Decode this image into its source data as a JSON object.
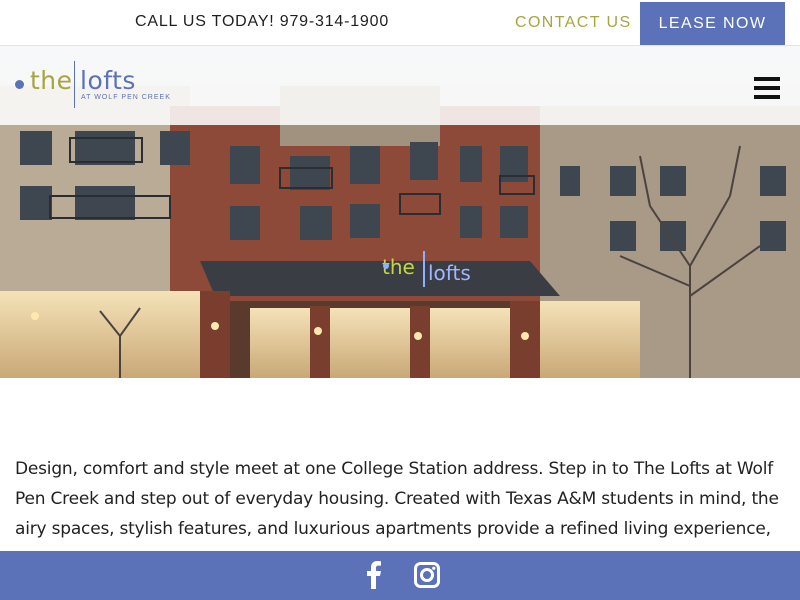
{
  "topbar": {
    "call_text": "CALL US TODAY! 979-314-1900",
    "contact_label": "CONTACT US",
    "lease_label": "LEASE NOW"
  },
  "header": {
    "logo": {
      "word_the": "the",
      "word_lofts": "lofts",
      "tagline": "AT WOLF PEN CREEK"
    },
    "menu_icon": "hamburger-menu-icon"
  },
  "hero": {
    "sign_the": "the",
    "sign_lofts": "lofts"
  },
  "intro": {
    "text": "Design, comfort and style meet at one College Station address. Step in to The Lofts at Wolf Pen Creek and step out of everyday housing. Created with Texas A&M students in mind, the airy spaces, stylish features, and luxurious apartments provide a refined living experience, unique in"
  },
  "social": {
    "icons": [
      "facebook-icon",
      "instagram-icon"
    ]
  },
  "colors": {
    "brand_blue": "#5b71b8",
    "brand_olive": "#a9a442",
    "text_dark": "#1f1f1f"
  }
}
